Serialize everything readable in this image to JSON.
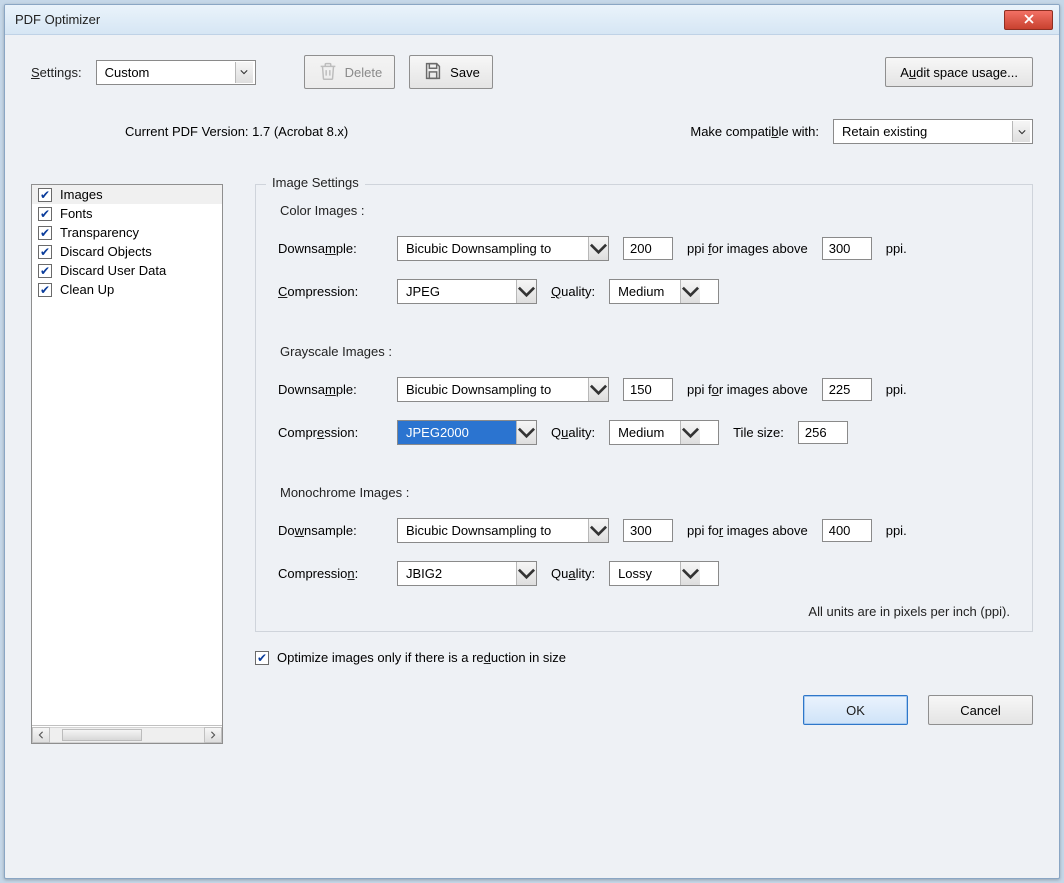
{
  "title": "PDF Optimizer",
  "settings_label": "Settings:",
  "settings_value": "Custom",
  "delete_label": "Delete",
  "save_label": "Save",
  "audit_label": "Audit space usage...",
  "current_version_label": "Current PDF Version: 1.7 (Acrobat 8.x)",
  "compat_label": "Make compatible with:",
  "compat_value": "Retain existing",
  "sidebar": {
    "items": [
      {
        "label": "Images",
        "checked": true,
        "selected": true
      },
      {
        "label": "Fonts",
        "checked": true,
        "selected": false
      },
      {
        "label": "Transparency",
        "checked": true,
        "selected": false
      },
      {
        "label": "Discard Objects",
        "checked": true,
        "selected": false
      },
      {
        "label": "Discard User Data",
        "checked": true,
        "selected": false
      },
      {
        "label": "Clean Up",
        "checked": true,
        "selected": false
      }
    ]
  },
  "panel": {
    "legend": "Image Settings",
    "color_head": "Color Images :",
    "gray_head": "Grayscale Images :",
    "mono_head": "Monochrome Images :",
    "downsample_label": "Downsample:",
    "compression_label": "Compression:",
    "quality_label": "Quality:",
    "ppi_for_label": "ppi for images above",
    "ppi_tail": "ppi.",
    "tile_label": "Tile size:",
    "color": {
      "downsample": "Bicubic Downsampling to",
      "ppi": "200",
      "above": "300",
      "compression": "JPEG",
      "quality": "Medium"
    },
    "gray": {
      "downsample": "Bicubic Downsampling to",
      "ppi": "150",
      "above": "225",
      "compression": "JPEG2000",
      "quality": "Medium",
      "tile": "256"
    },
    "mono": {
      "downsample": "Bicubic Downsampling to",
      "ppi": "300",
      "above": "400",
      "compression": "JBIG2",
      "quality": "Lossy"
    },
    "units_note": "All units are in pixels per inch (ppi).",
    "optimize_label": "Optimize images only if there is a reduction in size",
    "optimize_checked": true
  },
  "buttons": {
    "ok": "OK",
    "cancel": "Cancel"
  }
}
